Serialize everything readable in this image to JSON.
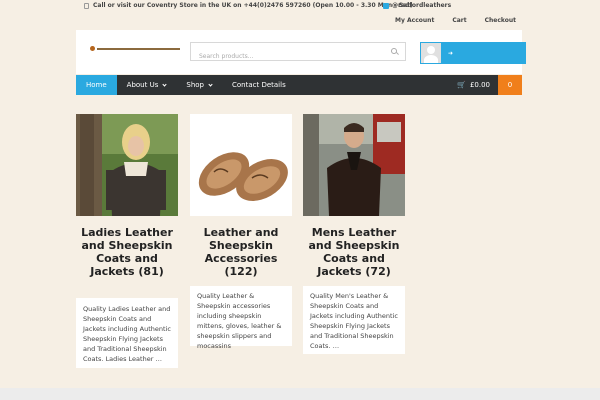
{
  "topbar": {
    "notice": "Call or visit our Coventry Store in the UK on +44(0)2476 597260 (Open 10.00 - 3.30 Mon - Sat)",
    "twitter": "@radfordleathers",
    "links": [
      "My Account",
      "Cart",
      "Checkout"
    ]
  },
  "search": {
    "placeholder": "Search products..."
  },
  "nav": {
    "items": [
      {
        "label": "Home",
        "active": true,
        "dropdown": false
      },
      {
        "label": "About Us",
        "active": false,
        "dropdown": true
      },
      {
        "label": "Shop",
        "active": false,
        "dropdown": true
      },
      {
        "label": "Contact Details",
        "active": false,
        "dropdown": false
      }
    ],
    "cart_total": "£0.00",
    "cart_count": "0"
  },
  "products": [
    {
      "title": "Ladies Leather and Sheepskin Coats and Jackets (81)",
      "description": "Quality Ladies Leather and Sheepskin Coats and Jackets including Authentic Sheepskin Flying Jackets and Traditional Sheepskin Coats. Ladies Leather …"
    },
    {
      "title": "Leather and Sheepskin Accessories (122)",
      "description": "Quality Leather & Sheepskin accessories including sheepskin mittens, gloves, leather & sheepskin slippers and mocassins"
    },
    {
      "title": "Mens Leather and Sheepskin Coats and Jackets (72)",
      "description": "Quality Men's Leather & Sheepskin Coats and Jackets  including Authentic Sheepskin Flying Jackets and Traditional Sheepskin Coats.  …"
    }
  ],
  "colors": {
    "accent": "#2aa9e0",
    "nav": "#2f3234",
    "cart_badge": "#f07f1b",
    "background": "#f6efe4"
  }
}
